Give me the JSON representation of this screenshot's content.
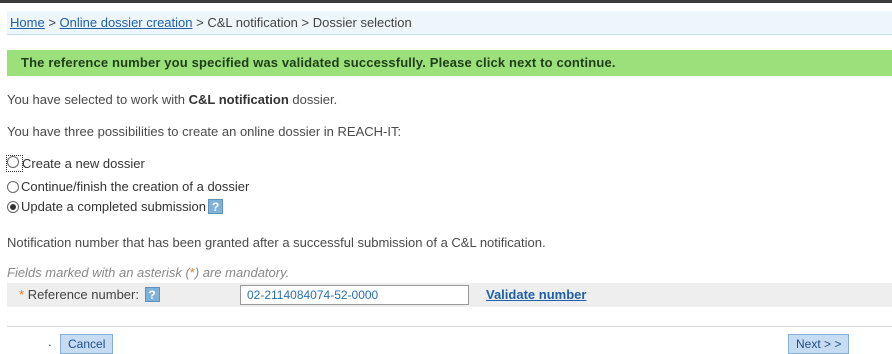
{
  "breadcrumb": {
    "home": "Home",
    "sep1": ">",
    "online": "Online dossier creation",
    "sep2": ">",
    "cl": "C&L notification",
    "sep3": ">",
    "current": "Dossier selection"
  },
  "success_message": "The reference number you specified was validated successfully. Please click next to continue.",
  "selected_text": {
    "before": "You have selected to work with ",
    "bold": "C&L notification",
    "after": " dossier."
  },
  "possibilities_text": "You have three possibilities to create an online dossier in REACH-IT:",
  "options": [
    {
      "label": "Create a new dossier",
      "selected": false
    },
    {
      "label": "Continue/finish the creation of a dossier",
      "selected": false
    },
    {
      "label": "Update a completed submission",
      "selected": true
    }
  ],
  "help_glyph": "?",
  "notification_text": "Notification number that has been granted after a successful submission of a C&L notification.",
  "mandatory_hint": {
    "before": "Fields marked with an asterisk (",
    "asterisk": "*",
    "after": ") are mandatory."
  },
  "reference": {
    "asterisk": "*",
    "label": "Reference number:",
    "value": "02-2114084074-52-0000",
    "validate_link": "Validate number"
  },
  "footer": {
    "dot": ".",
    "cancel": "Cancel",
    "next": "Next > >"
  },
  "colors": {
    "success_bg": "#9be07a",
    "link": "#1f5fa8",
    "breadcrumb_bg": "#ecf6fb",
    "button_bg": "#c6dcf2"
  },
  "icons": {
    "help": "help-icon",
    "radio": "radio-button"
  }
}
